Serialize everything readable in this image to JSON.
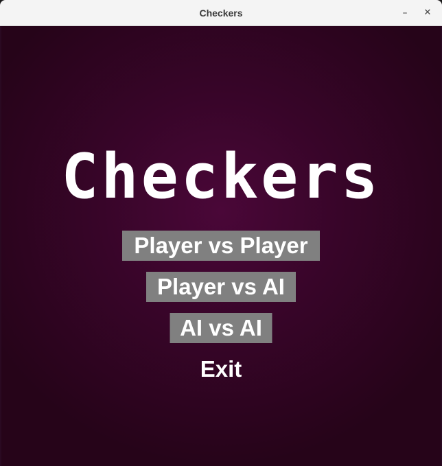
{
  "window": {
    "title": "Checkers",
    "minimize_glyph": "–",
    "close_glyph": "✕"
  },
  "game": {
    "title": "Checkers",
    "menu": [
      {
        "label": "Player vs Player"
      },
      {
        "label": "Player vs AI"
      },
      {
        "label": "AI vs AI"
      },
      {
        "label": "Exit"
      }
    ]
  },
  "colors": {
    "background": "#380529",
    "button": "#808080",
    "text": "#ffffff"
  }
}
